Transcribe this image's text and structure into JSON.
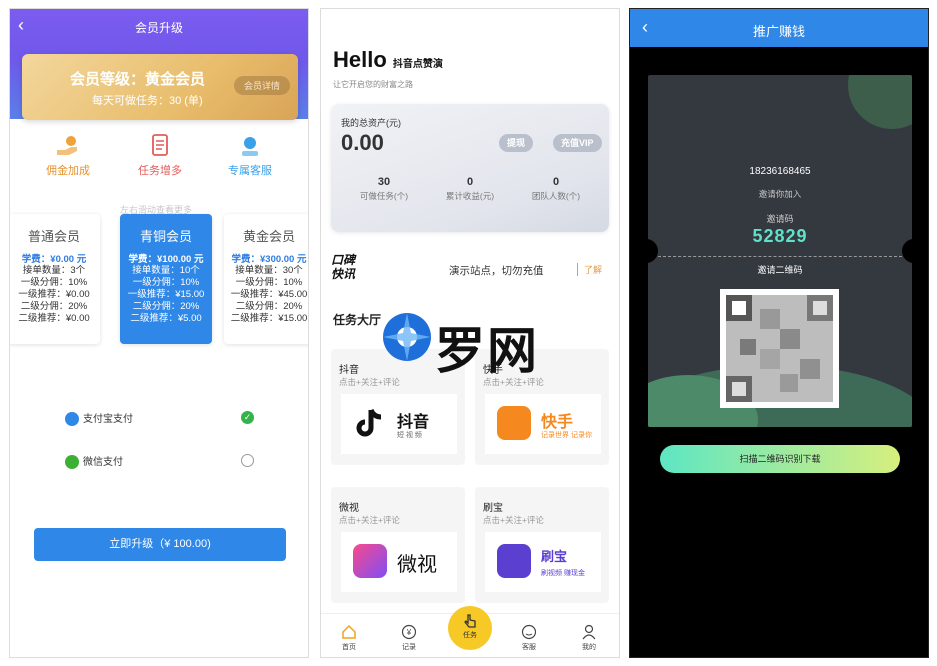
{
  "membership": {
    "title": "会员升级",
    "level": "会员等级：黄金会员",
    "daily_tasks": "每天可做任务：30 (单)",
    "detail_button": "会员详情",
    "features": [
      "佣金加成",
      "任务增多",
      "专属客服"
    ],
    "scroll_tip": "左右滑动查看更多",
    "tiers": [
      {
        "name": "普通会员",
        "fee": "学费：¥0.00 元",
        "lines": [
          "接单数量：3个",
          "一级分佣：10%",
          "一级推荐：¥0.00",
          "二级分佣：20%",
          "二级推荐：¥0.00"
        ]
      },
      {
        "name": "青铜会员",
        "fee": "学费：¥100.00 元",
        "lines": [
          "接单数量：10个",
          "一级分佣：10%",
          "一级推荐：¥15.00",
          "二级分佣：20%",
          "二级推荐：¥5.00"
        ]
      },
      {
        "name": "黄金会员",
        "fee": "学费：¥300.00 元",
        "lines": [
          "接单数量：30个",
          "一级分佣：10%",
          "一级推荐：¥45.00",
          "二级分佣：20%",
          "二级推荐：¥15.00"
        ]
      }
    ],
    "payments": [
      "支付宝支付",
      "微信支付"
    ],
    "upgrade_button": "立即升级（¥ 100.00)",
    "colors": {
      "header": "#7c5cf0",
      "accent": "#2f87e8",
      "gold": "#e8bd6c"
    }
  },
  "home": {
    "hello": "Hello",
    "hello_name": "抖音点赞演",
    "subtitle": "让它开启您的财富之路",
    "asset_label": "我的总资产(元)",
    "asset_value": "0.00",
    "withdraw": "提现",
    "recharge_vip": "充值VIP",
    "stats": [
      {
        "value": "30",
        "label": "可做任务(个)"
      },
      {
        "value": "0",
        "label": "累计收益(元)"
      },
      {
        "value": "0",
        "label": "团队人数(个)"
      }
    ],
    "brand_kb": [
      "口碑",
      "快讯"
    ],
    "notice": "演示站点，切勿充值",
    "notice_more": "了解",
    "task_header": "任务大厅",
    "tasks": [
      {
        "title": "抖音",
        "sub": "点击+关注+评论",
        "logo": "抖音",
        "logo_sub": "短 视 频"
      },
      {
        "title": "快手",
        "sub": "点击+关注+评论",
        "logo": "快手",
        "logo_sub": "记录世界 记录你"
      },
      {
        "title": "微视",
        "sub": "点击+关注+评论",
        "logo": "微视",
        "logo_sub": ""
      },
      {
        "title": "刷宝",
        "sub": "点击+关注+评论",
        "logo": "刷宝",
        "logo_sub": "刷视频 赚现金"
      }
    ],
    "watermark": "罗网",
    "tabs": [
      "首页",
      "记录",
      "任务",
      "客服",
      "我的"
    ]
  },
  "promo": {
    "title": "推广赚钱",
    "phone": "18236168465",
    "invite_text": "邀请你加入",
    "code_label": "邀请码",
    "code": "52829",
    "qr_label": "邀请二维码",
    "download_button": "扫描二维码识别下载"
  }
}
